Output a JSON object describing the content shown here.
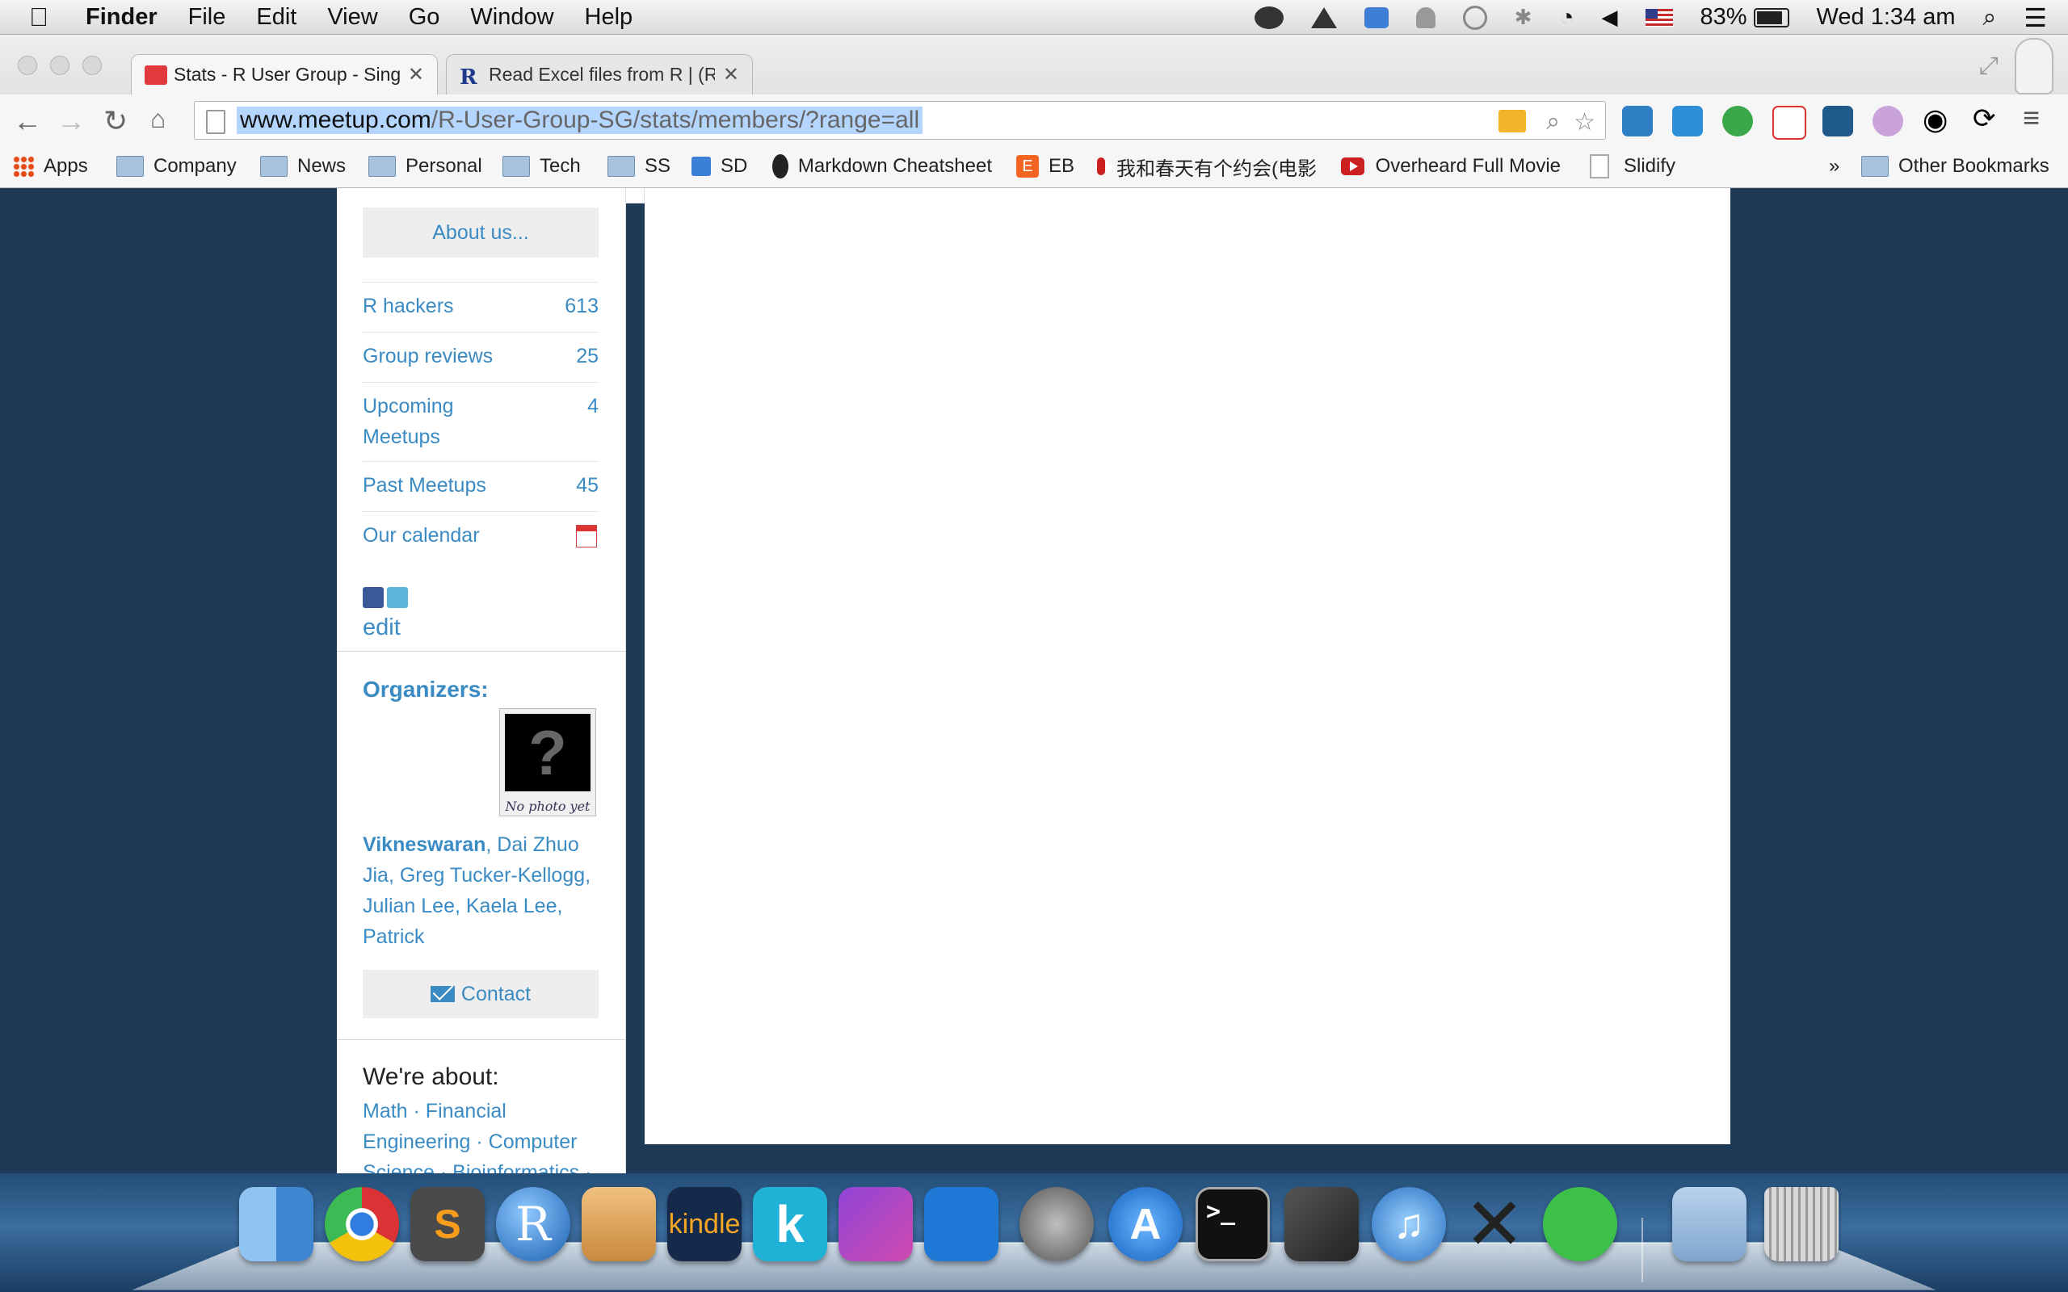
{
  "menubar": {
    "apple": "",
    "app_name": "Finder",
    "menus": [
      "File",
      "Edit",
      "View",
      "Go",
      "Window",
      "Help"
    ],
    "battery": "83%",
    "clock": "Wed 1:34 am",
    "tray_icons": [
      "wechat-icon",
      "google-drive-icon",
      "dropbox-icon",
      "notification-icon",
      "time-machine-icon",
      "bluetooth-icon",
      "wifi-icon",
      "volume-icon",
      "us-flag-icon"
    ]
  },
  "browser": {
    "tabs": [
      {
        "title": "Stats - R User Group - Singapore",
        "active": true
      },
      {
        "title": "Read Excel files from R | (R news & tutorials)",
        "active": false
      }
    ],
    "url_host": "www.meetup.com",
    "url_path": "/R-User-Group-SG/stats/members/?range=all",
    "bookmarks": [
      {
        "label": "Apps",
        "type": "apps"
      },
      {
        "label": "Company",
        "type": "folder"
      },
      {
        "label": "News",
        "type": "folder"
      },
      {
        "label": "Personal",
        "type": "folder"
      },
      {
        "label": "Tech",
        "type": "folder"
      },
      {
        "label": "SS",
        "type": "folder"
      },
      {
        "label": "SD",
        "type": "link"
      },
      {
        "label": "Markdown Cheatsheet",
        "type": "github"
      },
      {
        "label": "EB",
        "type": "link"
      },
      {
        "label": "我和春天有个约会(电影",
        "type": "youtube"
      },
      {
        "label": "Overheard Full Movie",
        "type": "youtube"
      },
      {
        "label": "Slidify",
        "type": "page"
      }
    ],
    "bookmarks_overflow": "»",
    "other_bookmarks": "Other Bookmarks"
  },
  "sidebar": {
    "about_button": "About us...",
    "stats": [
      {
        "label": "R hackers",
        "count": "613"
      },
      {
        "label": "Group reviews",
        "count": "25"
      },
      {
        "label": "Upcoming Meetups",
        "count": "4"
      },
      {
        "label": "Past Meetups",
        "count": "45"
      },
      {
        "label": "Our calendar",
        "count": ""
      }
    ],
    "edit_link": "edit",
    "organizers_title": "Organizers:",
    "no_photo_caption": "No photo yet",
    "organizers_lead": "Vikneswaran",
    "organizers_rest": ", Dai Zhuo Jia, Greg Tucker-Kellogg, Julian Lee, Kaela Lee, Patrick",
    "contact_button": "Contact",
    "about_heading": "We're about:",
    "about_tags": "Math · Financial Engineering · Computer Science · Bioinformatics ·"
  },
  "dock": {
    "apps": [
      "Finder",
      "Google Chrome",
      "Sublime Text",
      "R",
      "GitHub",
      "Kindle",
      "Kobo",
      "Mail App",
      "TeamViewer",
      "Launchpad",
      "App Store",
      "Terminal",
      "Steam",
      "iTunes",
      "X11",
      "WeChat",
      "Downloads",
      "Trash"
    ]
  },
  "colors": {
    "link": "#3a8bc4",
    "page_bg": "#1f3a56",
    "button_bg": "#eeeeee"
  }
}
